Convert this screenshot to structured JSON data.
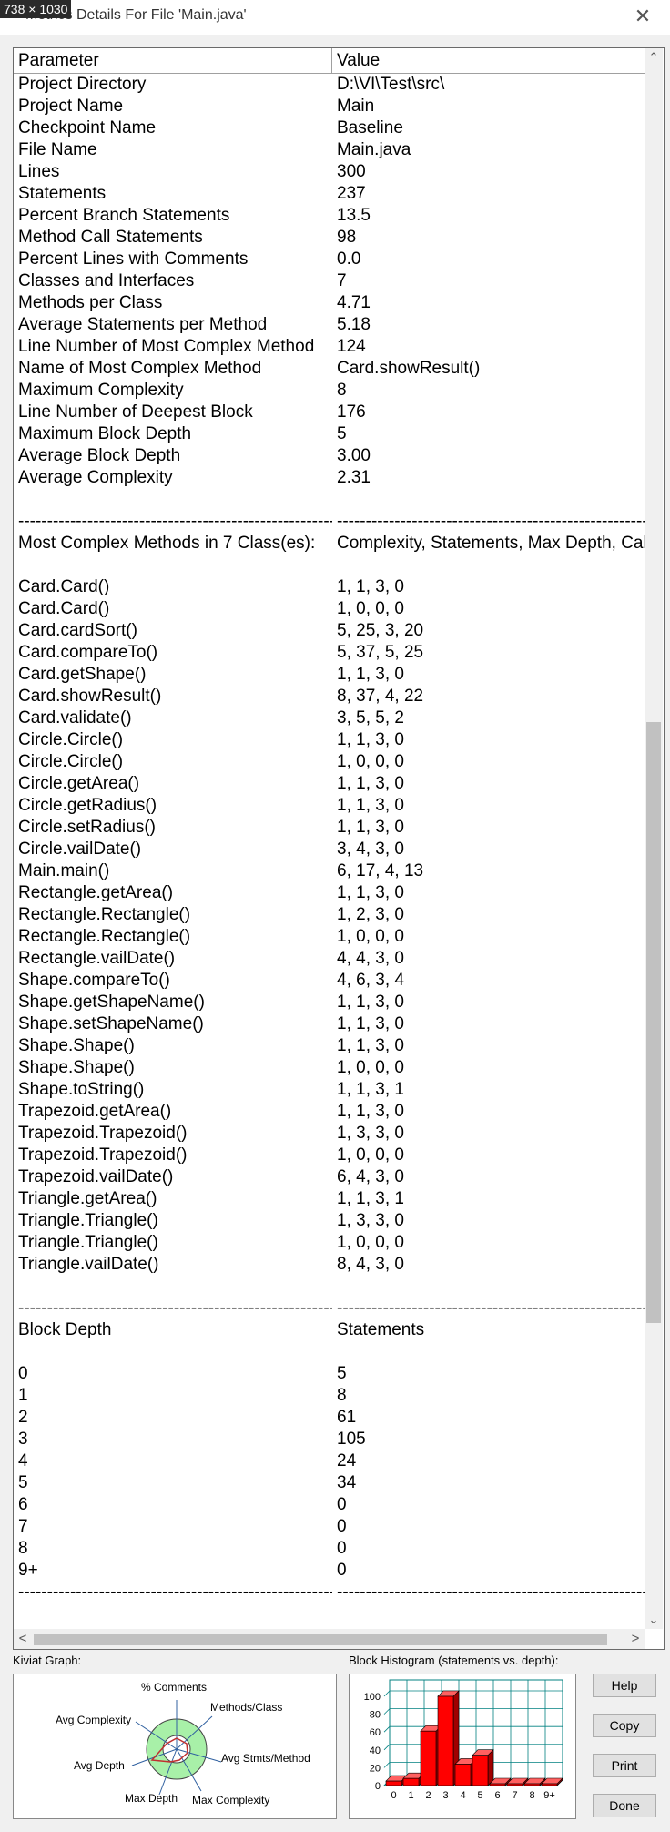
{
  "window": {
    "dimension_label": "738 × 1030",
    "title": "Metrics Details For File 'Main.java'",
    "close_glyph": "✕"
  },
  "table": {
    "headers": {
      "parameter": "Parameter",
      "value": "Value"
    },
    "rows": [
      [
        "Project Directory",
        "D:\\VI\\Test\\src\\"
      ],
      [
        "Project Name",
        "Main"
      ],
      [
        "Checkpoint Name",
        "Baseline"
      ],
      [
        "File Name",
        "Main.java"
      ],
      [
        "Lines",
        "300"
      ],
      [
        "Statements",
        "237"
      ],
      [
        "Percent Branch Statements",
        "13.5"
      ],
      [
        "Method Call Statements",
        "98"
      ],
      [
        "Percent Lines with Comments",
        "0.0"
      ],
      [
        "Classes and Interfaces",
        "7"
      ],
      [
        "Methods per Class",
        "4.71"
      ],
      [
        "Average Statements per Method",
        "5.18"
      ],
      [
        "Line Number of Most Complex Method",
        "124"
      ],
      [
        "Name of Most Complex Method",
        "Card.showResult()"
      ],
      [
        "Maximum Complexity",
        "8"
      ],
      [
        "Line Number of Deepest Block",
        "176"
      ],
      [
        "Maximum Block Depth",
        "5"
      ],
      [
        "Average Block Depth",
        "3.00"
      ],
      [
        "Average Complexity",
        "2.31"
      ],
      [
        "",
        ""
      ],
      [
        "--------------------------------------------------------",
        "--------------------------------------------------------"
      ],
      [
        "Most Complex Methods in 7 Class(es):",
        "Complexity, Statements, Max Depth, Calls"
      ],
      [
        "",
        ""
      ],
      [
        "Card.Card()",
        "1, 1, 3, 0"
      ],
      [
        "Card.Card()",
        "1, 0, 0, 0"
      ],
      [
        "Card.cardSort()",
        "5, 25, 3, 20"
      ],
      [
        "Card.compareTo()",
        "5, 37, 5, 25"
      ],
      [
        "Card.getShape()",
        "1, 1, 3, 0"
      ],
      [
        "Card.showResult()",
        "8, 37, 4, 22"
      ],
      [
        "Card.validate()",
        "3, 5, 5, 2"
      ],
      [
        "Circle.Circle()",
        "1, 1, 3, 0"
      ],
      [
        "Circle.Circle()",
        "1, 0, 0, 0"
      ],
      [
        "Circle.getArea()",
        "1, 1, 3, 0"
      ],
      [
        "Circle.getRadius()",
        "1, 1, 3, 0"
      ],
      [
        "Circle.setRadius()",
        "1, 1, 3, 0"
      ],
      [
        "Circle.vailDate()",
        "3, 4, 3, 0"
      ],
      [
        "Main.main()",
        "6, 17, 4, 13"
      ],
      [
        "Rectangle.getArea()",
        "1, 1, 3, 0"
      ],
      [
        "Rectangle.Rectangle()",
        "1, 2, 3, 0"
      ],
      [
        "Rectangle.Rectangle()",
        "1, 0, 0, 0"
      ],
      [
        "Rectangle.vailDate()",
        "4, 4, 3, 0"
      ],
      [
        "Shape.compareTo()",
        "4, 6, 3, 4"
      ],
      [
        "Shape.getShapeName()",
        "1, 1, 3, 0"
      ],
      [
        "Shape.setShapeName()",
        "1, 1, 3, 0"
      ],
      [
        "Shape.Shape()",
        "1, 1, 3, 0"
      ],
      [
        "Shape.Shape()",
        "1, 0, 0, 0"
      ],
      [
        "Shape.toString()",
        "1, 1, 3, 1"
      ],
      [
        "Trapezoid.getArea()",
        "1, 1, 3, 0"
      ],
      [
        "Trapezoid.Trapezoid()",
        "1, 3, 3, 0"
      ],
      [
        "Trapezoid.Trapezoid()",
        "1, 0, 0, 0"
      ],
      [
        "Trapezoid.vailDate()",
        "6, 4, 3, 0"
      ],
      [
        "Triangle.getArea()",
        "1, 1, 3, 1"
      ],
      [
        "Triangle.Triangle()",
        "1, 3, 3, 0"
      ],
      [
        "Triangle.Triangle()",
        "1, 0, 0, 0"
      ],
      [
        "Triangle.vailDate()",
        "8, 4, 3, 0"
      ],
      [
        "",
        ""
      ],
      [
        "--------------------------------------------------------",
        "--------------------------------------------------------"
      ],
      [
        "Block Depth",
        "Statements"
      ],
      [
        "",
        ""
      ],
      [
        "0",
        "5"
      ],
      [
        "1",
        "8"
      ],
      [
        "2",
        "61"
      ],
      [
        "3",
        "105"
      ],
      [
        "4",
        "24"
      ],
      [
        "5",
        "34"
      ],
      [
        "6",
        "0"
      ],
      [
        "7",
        "0"
      ],
      [
        "8",
        "0"
      ],
      [
        "9+",
        "0"
      ],
      [
        "--------------------------------------------------------",
        "--------------------------------------------------------"
      ]
    ]
  },
  "scrollbars": {
    "up": "⌃",
    "down": "⌄",
    "left": "<",
    "right": ">"
  },
  "kiviat": {
    "label": "Kiviat Graph:",
    "axes": [
      "% Comments",
      "Methods/Class",
      "Avg Stmts/Method",
      "Max Complexity",
      "Max Depth",
      "Avg Depth",
      "Avg Complexity"
    ]
  },
  "histogram": {
    "label": "Block Histogram (statements vs. depth):",
    "bar_color": "#ff0000",
    "grid_color": "#008080"
  },
  "chart_data": {
    "type": "bar",
    "title": "Block Histogram (statements vs. depth):",
    "categories": [
      "0",
      "1",
      "2",
      "3",
      "4",
      "5",
      "6",
      "7",
      "8",
      "9+"
    ],
    "values": [
      5,
      8,
      61,
      105,
      24,
      34,
      0,
      0,
      0,
      0
    ],
    "ylim": [
      0,
      100
    ],
    "yticks": [
      "0",
      "20",
      "40",
      "60",
      "80",
      "100"
    ],
    "grid": true
  },
  "buttons": {
    "help": "Help",
    "copy": "Copy",
    "print": "Print",
    "done": "Done"
  }
}
